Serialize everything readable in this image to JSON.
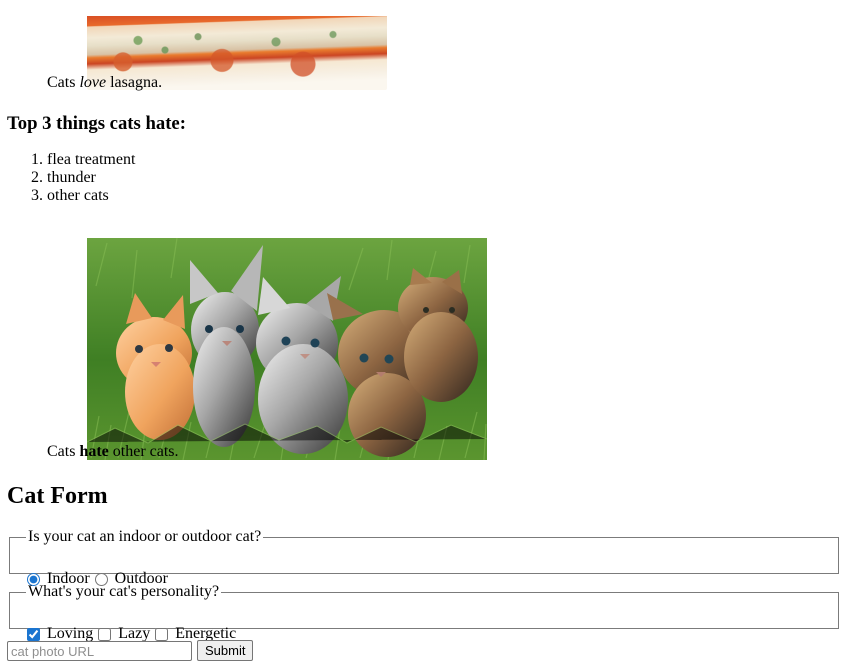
{
  "top_image": {
    "caption_before": "Cats ",
    "caption_emphasis": "love",
    "caption_after": " lasagna."
  },
  "hate_section": {
    "heading": "Top 3 things cats hate:",
    "items": [
      "flea treatment",
      "thunder",
      "other cats"
    ]
  },
  "kittens_image": {
    "caption_before": "Cats ",
    "caption_strong": "hate",
    "caption_after": " other cats."
  },
  "cat_form": {
    "heading": "Cat Form",
    "environment": {
      "legend": "Is your cat an indoor or outdoor cat?",
      "options": [
        {
          "label": "Indoor",
          "checked": true
        },
        {
          "label": "Outdoor",
          "checked": false
        }
      ]
    },
    "personality": {
      "legend": "What's your cat's personality?",
      "options": [
        {
          "label": "Loving",
          "checked": true
        },
        {
          "label": "Lazy",
          "checked": false
        },
        {
          "label": "Energetic",
          "checked": false
        }
      ]
    },
    "photo_url": {
      "value": "",
      "placeholder": "cat photo URL"
    },
    "submit_label": "Submit"
  },
  "colors": {
    "fieldset_border": "#7b7b7b",
    "control_accent": "#1b75d0",
    "button_background": "#efefef"
  }
}
